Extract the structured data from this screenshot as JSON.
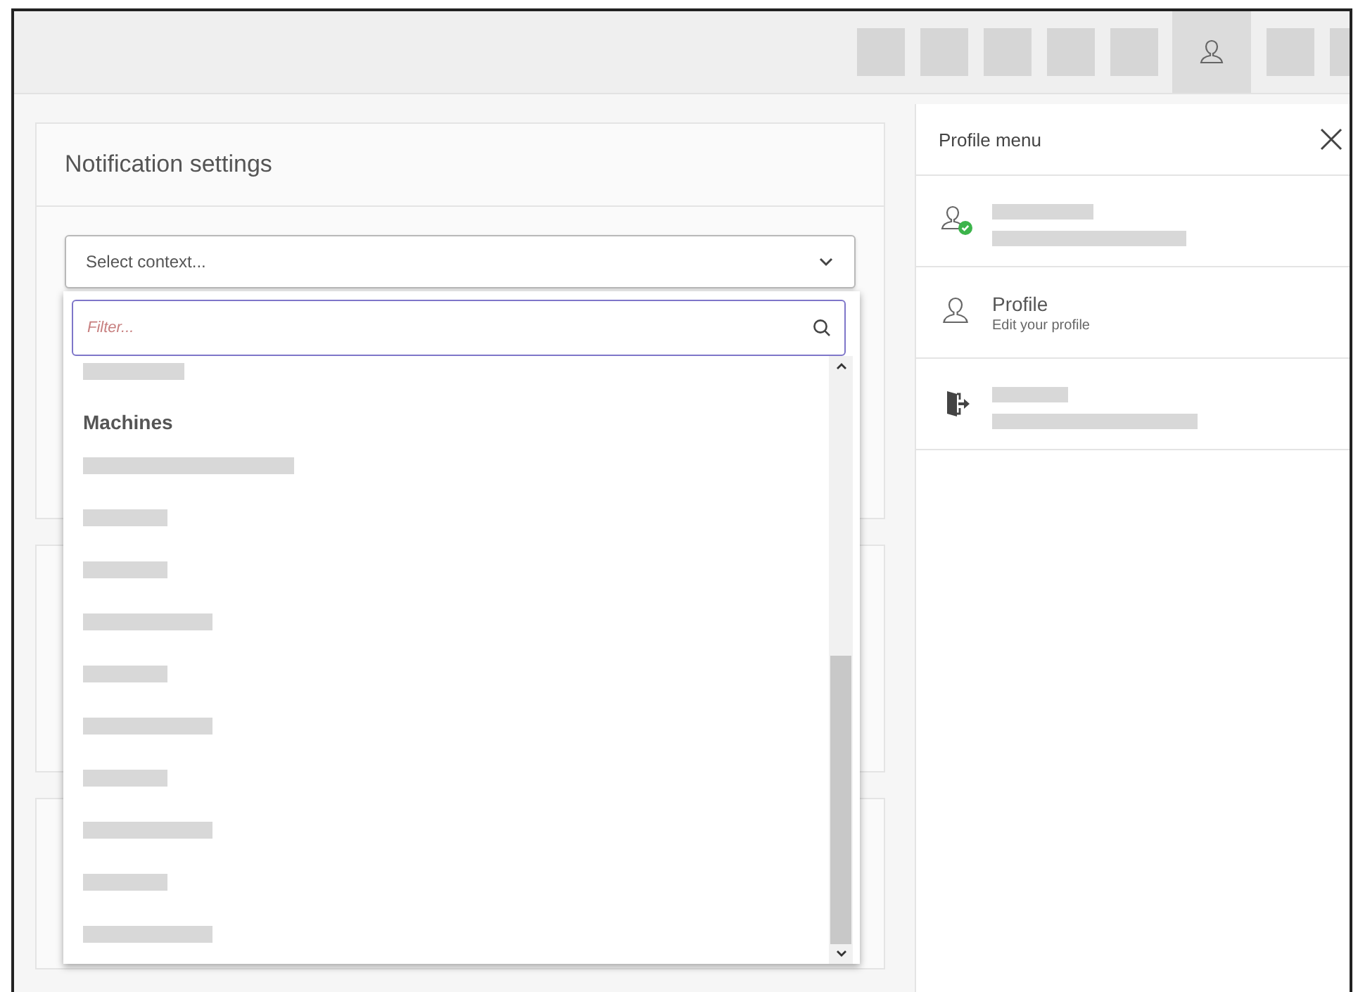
{
  "toolbar": {
    "items": [
      {
        "kind": "redacted",
        "selected": false
      },
      {
        "kind": "redacted",
        "selected": false
      },
      {
        "kind": "redacted",
        "selected": false
      },
      {
        "kind": "redacted",
        "selected": false
      },
      {
        "kind": "redacted",
        "selected": false
      },
      {
        "kind": "user",
        "selected": true
      },
      {
        "kind": "redacted",
        "selected": false
      },
      {
        "kind": "redacted",
        "selected": false
      }
    ]
  },
  "notification_settings": {
    "title": "Notification settings",
    "context_select": {
      "placeholder": "Select context...",
      "expanded": true
    },
    "dropdown": {
      "filter": {
        "placeholder": "Filter..."
      },
      "group_heading": "Machines"
    }
  },
  "profile_menu": {
    "title": "Profile menu",
    "items": [
      {
        "kind": "account"
      },
      {
        "kind": "profile",
        "title": "Profile",
        "subtitle": "Edit your profile"
      },
      {
        "kind": "logout"
      }
    ]
  }
}
